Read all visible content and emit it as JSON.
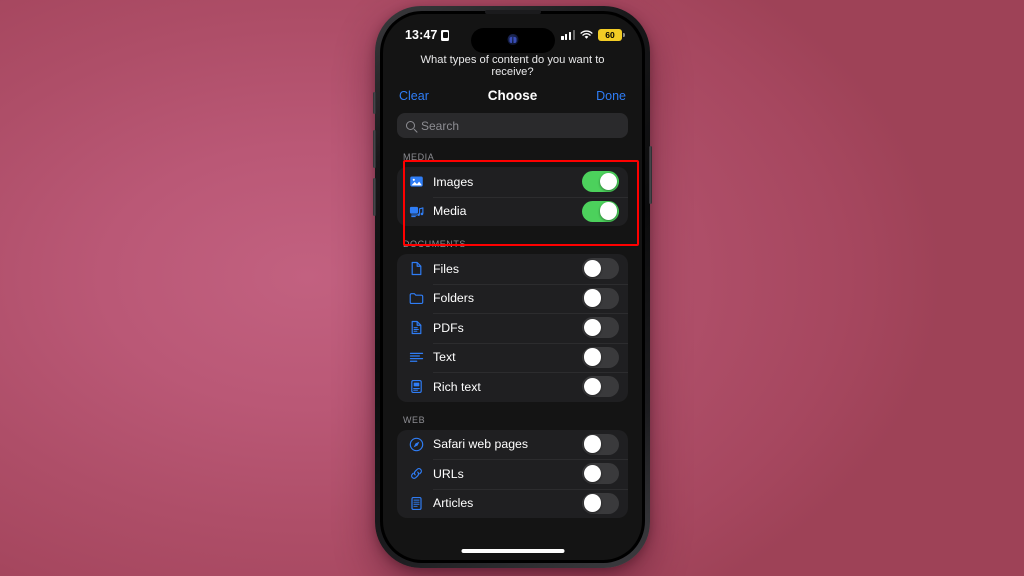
{
  "device": {
    "label": "iphone-frame"
  },
  "status_bar": {
    "time": "13:47",
    "lock_icon": "lock-portrait-orientation-icon",
    "cellular_icon": "cellular-signal-icon",
    "wifi_icon": "wifi-icon",
    "battery_percent": "60",
    "battery_color": "#F2CC25"
  },
  "sheet": {
    "prompt": "What types of content do you want to receive?",
    "clear_label": "Clear",
    "title": "Choose",
    "done_label": "Done",
    "accent_color": "#2F7DF6"
  },
  "search": {
    "placeholder": "Search",
    "value": "",
    "icon": "search-icon"
  },
  "sections": [
    {
      "title": "MEDIA",
      "highlighted": true,
      "rows": [
        {
          "label": "Images",
          "icon": "photo-icon",
          "toggle": "on"
        },
        {
          "label": "Media",
          "icon": "media-music-icon",
          "toggle": "on"
        }
      ]
    },
    {
      "title": "DOCUMENTS",
      "highlighted": false,
      "rows": [
        {
          "label": "Files",
          "icon": "file-icon",
          "toggle": "off"
        },
        {
          "label": "Folders",
          "icon": "folder-icon",
          "toggle": "off"
        },
        {
          "label": "PDFs",
          "icon": "pdf-doc-icon",
          "toggle": "off"
        },
        {
          "label": "Text",
          "icon": "text-lines-icon",
          "toggle": "off"
        },
        {
          "label": "Rich text",
          "icon": "rich-text-icon",
          "toggle": "off"
        }
      ]
    },
    {
      "title": "WEB",
      "highlighted": false,
      "rows": [
        {
          "label": "Safari web pages",
          "icon": "safari-compass-icon",
          "toggle": "off"
        },
        {
          "label": "URLs",
          "icon": "link-icon",
          "toggle": "off"
        },
        {
          "label": "Articles",
          "icon": "article-icon",
          "toggle": "off"
        }
      ]
    }
  ],
  "highlight": {
    "color": "#FF0000",
    "target_section": "MEDIA"
  },
  "home_indicator": {
    "label": "home-indicator"
  },
  "colors": {
    "background_rose": "#B5556F",
    "screen_bg": "#141414",
    "card_bg": "#1F1F21",
    "toggle_on": "#4CD15C",
    "toggle_off": "#3A3A3C",
    "icon_blue": "#2F7DF6"
  }
}
